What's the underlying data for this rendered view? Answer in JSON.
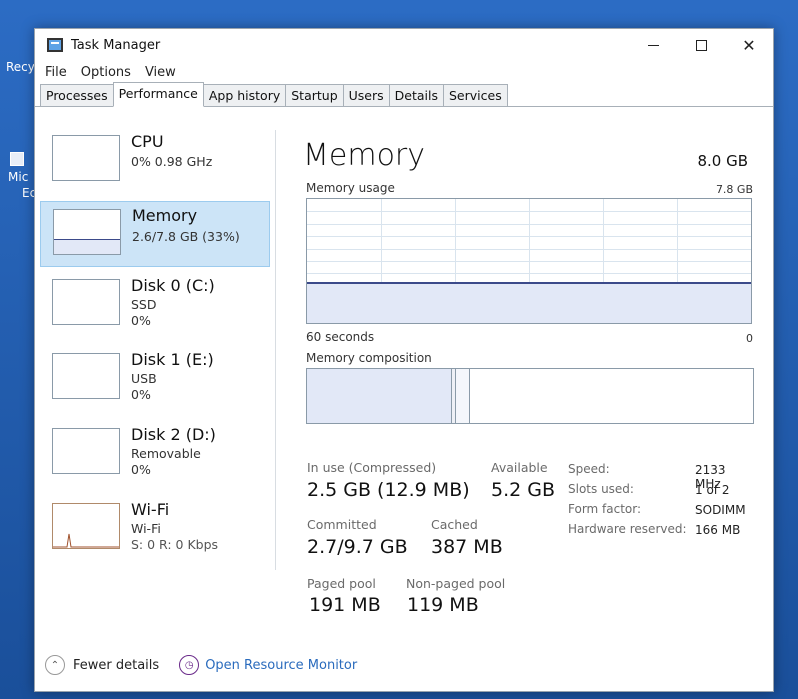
{
  "desktop": {
    "icon_labels": [
      "Recy",
      "Mic",
      "Ec"
    ]
  },
  "window": {
    "title": "Task Manager",
    "minimize": "—",
    "maximize": "□",
    "close": "✕"
  },
  "menu": [
    "File",
    "Options",
    "View"
  ],
  "tabs": [
    "Processes",
    "Performance",
    "App history",
    "Startup",
    "Users",
    "Details",
    "Services"
  ],
  "active_tab": "Performance",
  "sidebar": [
    {
      "title": "CPU",
      "line1": "0% 0.98 GHz",
      "line2": ""
    },
    {
      "title": "Memory",
      "line1": "2.6/7.8 GB (33%)",
      "line2": ""
    },
    {
      "title": "Disk 0 (C:)",
      "line1": "SSD",
      "line2": "0%"
    },
    {
      "title": "Disk 1 (E:)",
      "line1": "USB",
      "line2": "0%"
    },
    {
      "title": "Disk 2 (D:)",
      "line1": "Removable",
      "line2": "0%"
    },
    {
      "title": "Wi-Fi",
      "line1": "Wi-Fi",
      "line2": "S: 0 R: 0 Kbps"
    }
  ],
  "main": {
    "title": "Memory",
    "total": "8.0 GB",
    "usage_label": "Memory usage",
    "usage_max": "7.8 GB",
    "usage_fraction": 0.33,
    "time_left": "60 seconds",
    "time_right": "0",
    "composition_label": "Memory composition"
  },
  "stats": {
    "in_use_label": "In use (Compressed)",
    "in_use_value": "2.5 GB (12.9 MB)",
    "available_label": "Available",
    "available_value": "5.2 GB",
    "committed_label": "Committed",
    "committed_value": "2.7/9.7 GB",
    "cached_label": "Cached",
    "cached_value": "387 MB",
    "paged_label": "Paged pool",
    "paged_value": "191 MB",
    "nonpaged_label": "Non-paged pool",
    "nonpaged_value": "119 MB"
  },
  "specs": [
    {
      "label": "Speed:",
      "value": "2133 MHz"
    },
    {
      "label": "Slots used:",
      "value": "1 of 2"
    },
    {
      "label": "Form factor:",
      "value": "SODIMM"
    },
    {
      "label": "Hardware reserved:",
      "value": "166 MB"
    }
  ],
  "footer": {
    "fewer_details": "Fewer details",
    "open_monitor": "Open Resource Monitor"
  },
  "colors": {
    "selected_bg": "#cce4f7",
    "memory_line": "#3b4a8a",
    "link": "#2a6bbd"
  }
}
